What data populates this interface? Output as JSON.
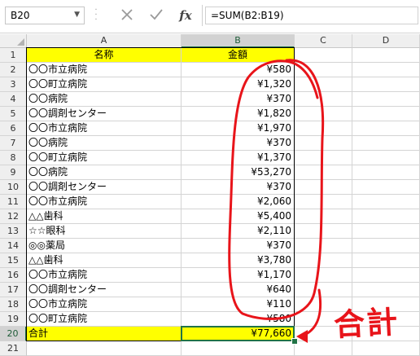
{
  "formula_bar": {
    "name_box": "B20",
    "cancel_icon": "cancel-icon",
    "enter_icon": "check-icon",
    "fx_label": "fx",
    "formula": "=SUM(B2:B19)"
  },
  "columns": [
    "A",
    "B",
    "C",
    "D"
  ],
  "selected_column": "B",
  "selected_row": "20",
  "header_row": {
    "row": "1",
    "name": "名称",
    "amount": "金額"
  },
  "rows": [
    {
      "row": "2",
      "name": "〇〇市立病院",
      "amount": "¥580"
    },
    {
      "row": "3",
      "name": "〇〇町立病院",
      "amount": "¥1,320"
    },
    {
      "row": "4",
      "name": "〇〇病院",
      "amount": "¥370"
    },
    {
      "row": "5",
      "name": "〇〇調剤センター",
      "amount": "¥1,820"
    },
    {
      "row": "6",
      "name": "〇〇市立病院",
      "amount": "¥1,970"
    },
    {
      "row": "7",
      "name": "〇〇病院",
      "amount": "¥370"
    },
    {
      "row": "8",
      "name": "〇〇町立病院",
      "amount": "¥1,370"
    },
    {
      "row": "9",
      "name": "〇〇病院",
      "amount": "¥53,270"
    },
    {
      "row": "10",
      "name": "〇〇調剤センター",
      "amount": "¥370"
    },
    {
      "row": "11",
      "name": "〇〇市立病院",
      "amount": "¥2,060"
    },
    {
      "row": "12",
      "name": "△△歯科",
      "amount": "¥5,400"
    },
    {
      "row": "13",
      "name": "☆☆眼科",
      "amount": "¥2,110"
    },
    {
      "row": "14",
      "name": "◎◎薬局",
      "amount": "¥370"
    },
    {
      "row": "15",
      "name": "△△歯科",
      "amount": "¥3,780"
    },
    {
      "row": "16",
      "name": "〇〇市立病院",
      "amount": "¥1,170"
    },
    {
      "row": "17",
      "name": "〇〇調剤センター",
      "amount": "¥640"
    },
    {
      "row": "18",
      "name": "〇〇市立病院",
      "amount": "¥110"
    },
    {
      "row": "19",
      "name": "〇〇町立病院",
      "amount": "¥580"
    }
  ],
  "total_row": {
    "row": "20",
    "name": "合計",
    "amount": "¥77,660"
  },
  "extra_rows": [
    "21"
  ],
  "annotation": {
    "text": "合計",
    "color": "#e8141a"
  },
  "colors": {
    "header_fill": "#ffff00",
    "selection": "#217346"
  }
}
